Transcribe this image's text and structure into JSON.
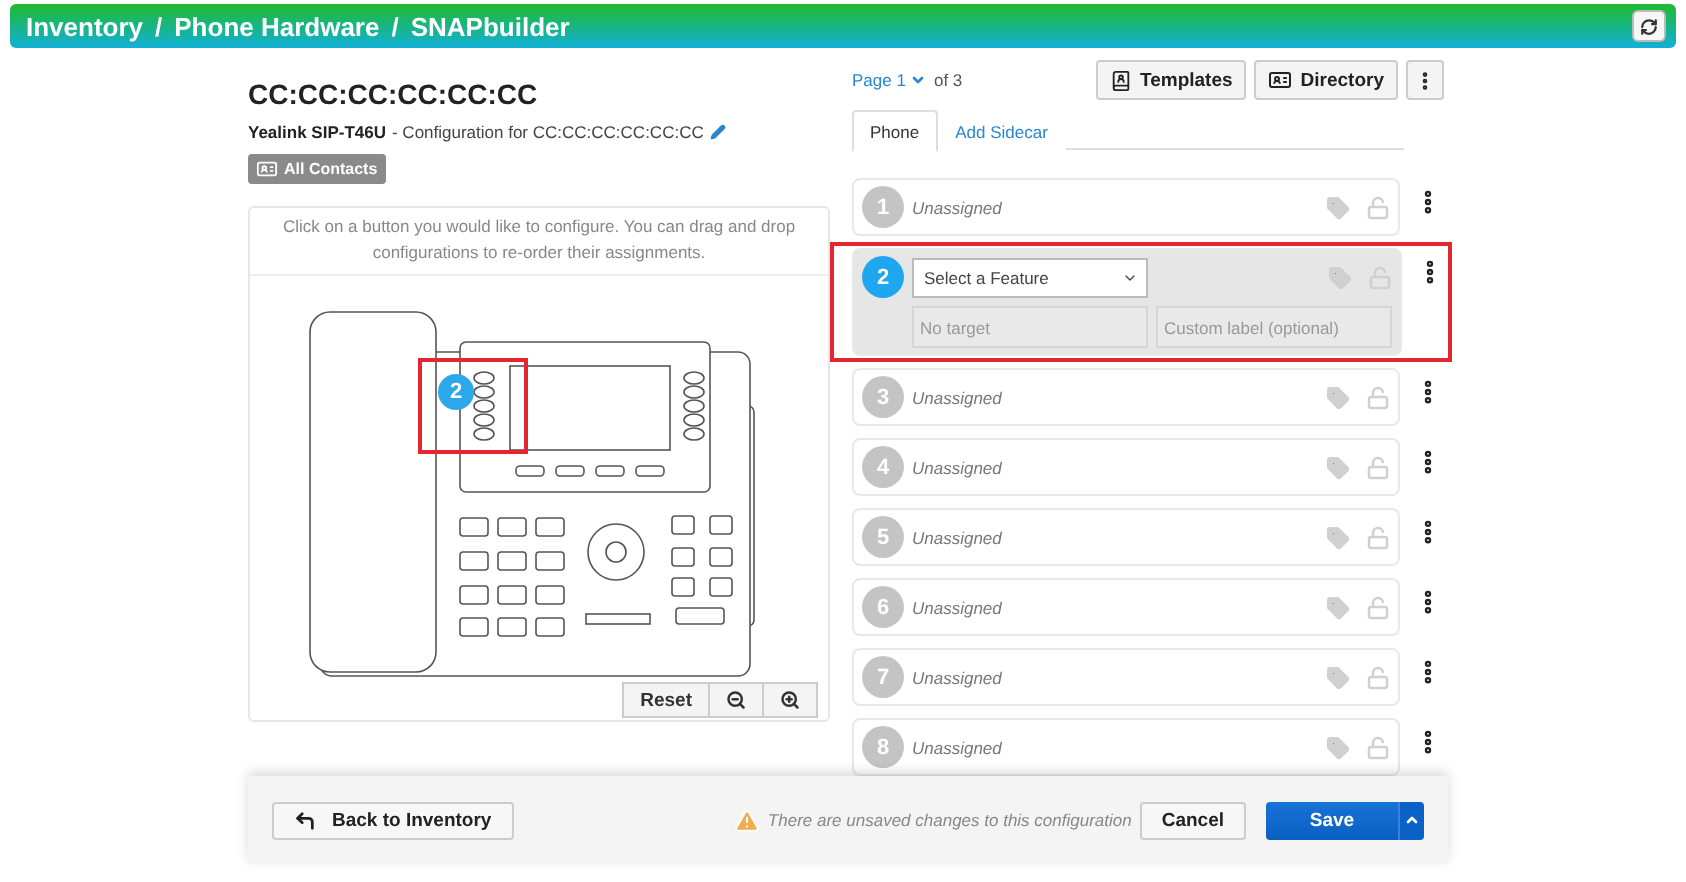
{
  "header": {
    "breadcrumbs": [
      "Inventory",
      "Phone Hardware",
      "SNAPbuilder"
    ],
    "separator": "/"
  },
  "device": {
    "title": "CC:CC:CC:CC:CC:CC",
    "model": "Yealink SIP-T46U",
    "config_text": "- Configuration for CC:CC:CC:CC:CC:CC",
    "contacts_button": "All Contacts"
  },
  "phone_panel": {
    "instructions": "Click on a button you would like to configure. You can drag and drop configurations to re-order their assignments.",
    "selected_key_badge": "2",
    "reset_button": "Reset"
  },
  "pager": {
    "label": "Page",
    "number": "1",
    "total": "of 3"
  },
  "toolbar": [
    "Templates",
    "Directory"
  ],
  "tabs": [
    {
      "label": "Phone",
      "selected": true
    },
    {
      "label": "Add Sidecar",
      "selected": false
    }
  ],
  "keys": [
    {
      "number": "1",
      "label": "Unassigned",
      "selected": false
    },
    {
      "number": "2",
      "selected": true,
      "feature_placeholder": "Select a Feature",
      "target_placeholder": "No target",
      "label_placeholder": "Custom label (optional)"
    },
    {
      "number": "3",
      "label": "Unassigned",
      "selected": false
    },
    {
      "number": "4",
      "label": "Unassigned",
      "selected": false
    },
    {
      "number": "5",
      "label": "Unassigned",
      "selected": false
    },
    {
      "number": "6",
      "label": "Unassigned",
      "selected": false
    },
    {
      "number": "7",
      "label": "Unassigned",
      "selected": false
    },
    {
      "number": "8",
      "label": "Unassigned",
      "selected": false
    }
  ],
  "footer": {
    "back_button": "Back to Inventory",
    "warning": "There are unsaved changes to this configuration",
    "cancel_button": "Cancel",
    "save_button": "Save"
  }
}
